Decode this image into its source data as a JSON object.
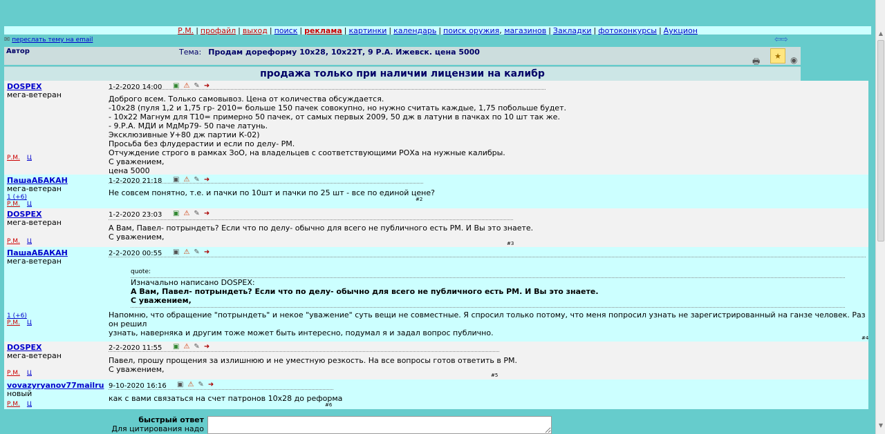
{
  "nav": {
    "pm": "Р.М.",
    "profile": "профайл",
    "logout": "выход",
    "search": "поиск",
    "ads": "реклама",
    "pictures": "картинки",
    "calendar": "календарь",
    "weapon_search": "поиск оружия",
    "shops": "магазинов",
    "bookmarks": "Закладки",
    "photo_contests": "фотоконкурсы",
    "auction": "Аукцион"
  },
  "email_link": "переслать тему на email",
  "header": {
    "author_label": "Автор",
    "topic_label": "Тема:",
    "topic_title": "Продам дореформу 10х28, 10х22Т, 9 Р.А. Ижевск. цена 5000"
  },
  "subtitle": "продажа только при наличии лицензии на калибр",
  "posts": [
    {
      "author": "DOSPEX",
      "rank": "мега-ветеран",
      "time": "1-2-2020 14:00",
      "props": "",
      "pm": "Р.М.",
      "ignore": "Ц",
      "number": "",
      "lines": [
        "Доброго всем. Только самовывоз. Цена от количества обсуждается.",
        "-10х28 (пуля 1,2 и 1,75 гр- 2010= больше 150 пачек совокупно, но нужно считать каждые, 1,75 побольше будет.",
        "- 10х22 Магнум для Т10= примерно 50 пачек, от самых первых 2009, 50 дж в латуни в пачках по 10 шт так же.",
        "- 9.Р.А. МДИ и МдМр79- 50 паче латунь.",
        "Эксклюзивные У+80 дж партии К-02)",
        "Просьба без флудерастии и если по делу- РМ.",
        "Отчуждение строго в рамках ЗоО, на владельцев с соответствующими РОХа на нужные калибры.",
        "С уважением,",
        "цена 5000"
      ]
    },
    {
      "author": "ПашаАБАКАН",
      "rank": "мега-ветеран",
      "time": "1-2-2020 21:18",
      "props": "1 (+6)",
      "pm": "Р.М.",
      "ignore": "Ц",
      "number": "#2",
      "lines": [
        "Не совсем понятно, т.е. и пачки по 10шт и пачки по 25 шт - все по единой цене?"
      ]
    },
    {
      "author": "DOSPEX",
      "rank": "мега-ветеран",
      "time": "1-2-2020 23:03",
      "props": "",
      "pm": "Р.М.",
      "ignore": "Ц",
      "number": "#3",
      "lines": [
        "А Вам, Павел- потрындеть? Если что по делу- обычно для всего не публичного есть РМ. И Вы это знаете.",
        "С уважением,"
      ]
    },
    {
      "author": "ПашаАБАКАН",
      "rank": "мега-ветеран",
      "time": "2-2-2020 00:55",
      "props": "1 (+6)",
      "pm": "Р.М.",
      "ignore": "Ц",
      "number": "#4",
      "quote_label": "quote:",
      "quote_author": "Изначально написано DOSPEX:",
      "quote_lines": [
        "А Вам, Павел- потрындеть? Если что по делу- обычно для всего не публичного есть РМ. И Вы это знаете.",
        "С уважением,"
      ],
      "lines": [
        "Напомню, что обращение \"потрындеть\" и некое \"уважение\" суть вещи не совместные. Я спросил только потому, что меня попросил узнать не зарегистрированный на ганзе человек. Раз он решил",
        "узнать, наверняка и другим тоже может быть интересно, подумал я и задал вопрос публично."
      ]
    },
    {
      "author": "DOSPEX",
      "rank": "мега-ветеран",
      "time": "2-2-2020 11:55",
      "props": "",
      "pm": "Р.М.",
      "ignore": "Ц",
      "number": "#5",
      "lines": [
        "Павел, прошу прощения за излишнюю и не уместную резкость. На все вопросы готов ответить в РМ.",
        "С уважением,"
      ]
    },
    {
      "author": "vovazyryanov77mailru",
      "rank": "новый",
      "time": "9-10-2020 16:16",
      "props": "",
      "pm": "Р.М.",
      "ignore": "Ц",
      "number": "#6",
      "lines": [
        "как с вами связаться на счет патронов 10х28 до реформа"
      ]
    }
  ],
  "quick_reply": {
    "title": "быстрый ответ",
    "quote_hint": "Для цитирования надо"
  },
  "colors": {
    "page_bg": "#66cccc",
    "post_alt_bg": "#ccffff",
    "post_bg": "#f2f2f2",
    "link": "#0000cc",
    "pm_red": "#cc0000"
  }
}
